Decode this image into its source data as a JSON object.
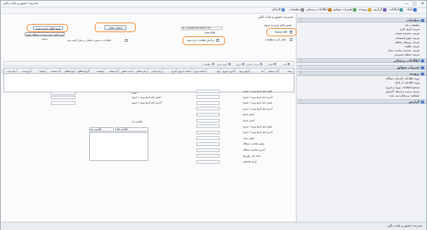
{
  "window": {
    "title": "مدیریت حضور و غیاب پالیز",
    "controls": [
      "—",
      "▢",
      "✕"
    ]
  },
  "menu": [
    {
      "label": "کارتابل",
      "icon": "calendar-icon",
      "color": "#6b8fd1"
    },
    {
      "label": "تنظیمات",
      "icon": "gear-icon",
      "color": "#8a8a8a"
    },
    {
      "label": "اطلاعات پرسنلی",
      "icon": "people-icon",
      "color": "#c77a2a"
    },
    {
      "label": "تغییرات سوابق",
      "icon": "records-icon",
      "color": "#5aa35a"
    },
    {
      "label": "پرونده",
      "icon": "folder-icon",
      "color": "#d9a83a"
    },
    {
      "label": "گزارش",
      "icon": "report-icon",
      "color": "#7c5fb5"
    },
    {
      "label": "امکانات",
      "icon": "tools-icon",
      "color": "#4f9bb0"
    },
    {
      "label": "کمک",
      "icon": "help-icon",
      "color": "#3a73c9"
    }
  ],
  "pane_title": "مدیریت حضور و غیاب پالیز",
  "sidebar": {
    "sections": [
      {
        "label": "تنظیمات",
        "items": [
          "تنظیمات پایه",
          "تعریف گروه کاری",
          "تعریف محدوده شیفت",
          "تعریف انواع استخدام",
          "تعریف روزهای تعطیل",
          "تعریف تکلیف",
          "تعریف محدوده ساعت مجاز",
          "تعریف سطح دسترسی"
        ]
      },
      {
        "label": "اطلاعات پرسنلی",
        "items": []
      },
      {
        "label": "تغییرات سوابق",
        "items": []
      },
      {
        "label": "پرونده",
        "items": [
          "ورود اطلاعات کارتابل دستگاه",
          "ورود اطلاعات از فایل",
          "تصحیح اطلاعات ورود و خروج",
          "تعریف و ثبت و ارسال گزارش",
          "مشاهده ترددهای ثبت شده"
        ]
      },
      {
        "label": "گزارش",
        "items": []
      }
    ]
  },
  "form": {
    "device_label": "مسیر فایل ورود و خروج",
    "device_path": "K:\\ 14040520183O.TXT",
    "browse_label": "Use USB",
    "use_usb_label": "Taiwo USB",
    "fast_load_label": "فعال کردن تنظیمات",
    "select_file_button": "انتخاب فایل",
    "transfer_button": "پردازش اطلاعات وارد شده",
    "read_card_button": "ورود فایل ذخیره شده",
    "read_device_button": "ورود فایل ذخیره شده از دستگاه حضور و غیاب",
    "same_day_label": "اطلاعات به صورت یکسان در نظر گرفته شود"
  },
  "filter": {
    "items": [
      "ثبت",
      "فیلتر",
      "مرتب سازی",
      "تاریخ",
      "گروه بندی",
      "تنظیمات"
    ]
  },
  "grid": {
    "columns": [
      "ردیف",
      "کد پرسنلی",
      "نام",
      "اولین ورود",
      "آخرین خروج",
      "نوع",
      "ساعت ورود",
      "ساعت خروج",
      "تاریخ",
      "زمان تاخیر",
      "زمان تعجیل",
      "مدت حضور",
      "کد شیفت",
      "وضعیت",
      "تاریخ تعطیل",
      "نوع تعطیل",
      "کد شیفت",
      "توضیح",
      "تاریخ ثبت",
      "زمان ثبت"
    ]
  },
  "right_fields": [
    "اولین ایتم تاریخ ورود / خروج",
    "آخرین ایتم تاریخ ورود / خروج",
    "اولین ایتم تاریخ ورود / خروج",
    "آخرین ایتم تاریخ ورود / خروج",
    "اولین تاریخ",
    "آخرین تاریخ",
    "اولین ایتم تاریخ ورود / خروج",
    "آخرین ایتم تاریخ ورود / خروج",
    "اولین زمان",
    "اولین شناسه دستگاه",
    "آخرین شناسه دستگاه",
    "تعداد کل رکوردها",
    "تاریخ تشخیص"
  ],
  "mid_fields": [
    "تعداد",
    "اولین ایتم تاریخ ورود / خروج",
    "آخرین ایتم تاریخ ورود / خروج",
    "نگاشت کد"
  ],
  "mid_dropdowns": [
    "نگاشت کد",
    "نگاشت به"
  ],
  "status": {
    "text": "مدیریت حضور و غیاب پالیز"
  }
}
